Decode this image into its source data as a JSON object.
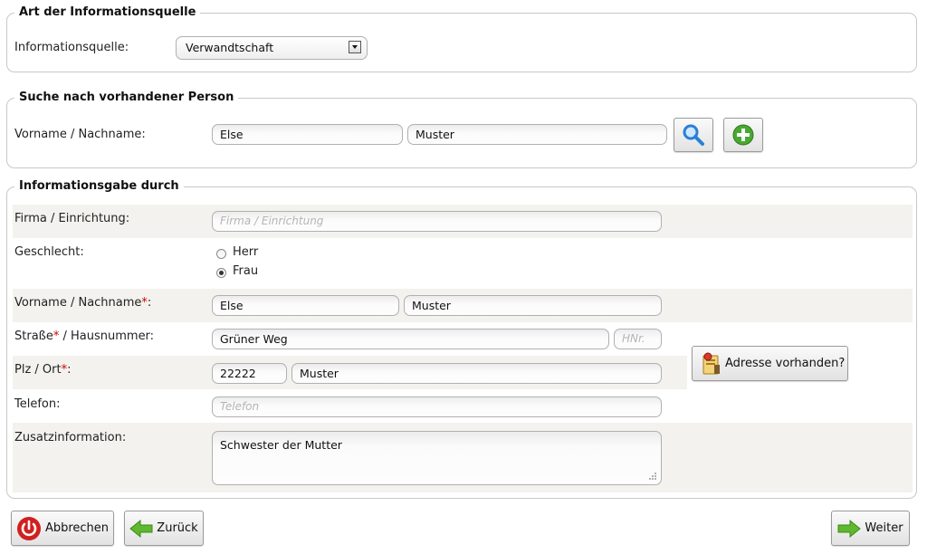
{
  "info_source": {
    "legend": "Art der Informationsquelle",
    "label": "Informationsquelle:",
    "selected": "Verwandtschaft"
  },
  "search": {
    "legend": "Suche nach vorhandener Person",
    "label": "Vorname / Nachname:",
    "first_name": "Else",
    "last_name": "Muster"
  },
  "provider": {
    "legend": "Informationsgabe durch",
    "company_label": "Firma / Einrichtung:",
    "company_placeholder": "Firma / Einrichtung",
    "gender_label": "Geschlecht:",
    "gender_options": [
      "Herr",
      "Frau"
    ],
    "gender_selected": "Frau",
    "name_label": "Vorname / Nachname",
    "first_name": "Else",
    "last_name": "Muster",
    "street_label_a": "Straße",
    "street_label_b": " / Hausnummer:",
    "street": "Grüner Weg",
    "house_placeholder": "HNr.",
    "zip_label": "Plz / Ort",
    "zip": "22222",
    "city": "Muster",
    "phone_label": "Telefon:",
    "phone_placeholder": "Telefon",
    "extra_label": "Zusatzinformation:",
    "extra_text": "Schwester der Mutter",
    "address_button": "Adresse vorhanden?",
    "required_mark": "*",
    "colon": ":"
  },
  "footer": {
    "cancel": "Abbrechen",
    "back": "Zurück",
    "next": "Weiter"
  },
  "colors": {
    "required": "#d40000",
    "row_shade": "#f3f2ee",
    "cancel_icon": "#d21f1f",
    "arrow_icon": "#5fb82f"
  }
}
